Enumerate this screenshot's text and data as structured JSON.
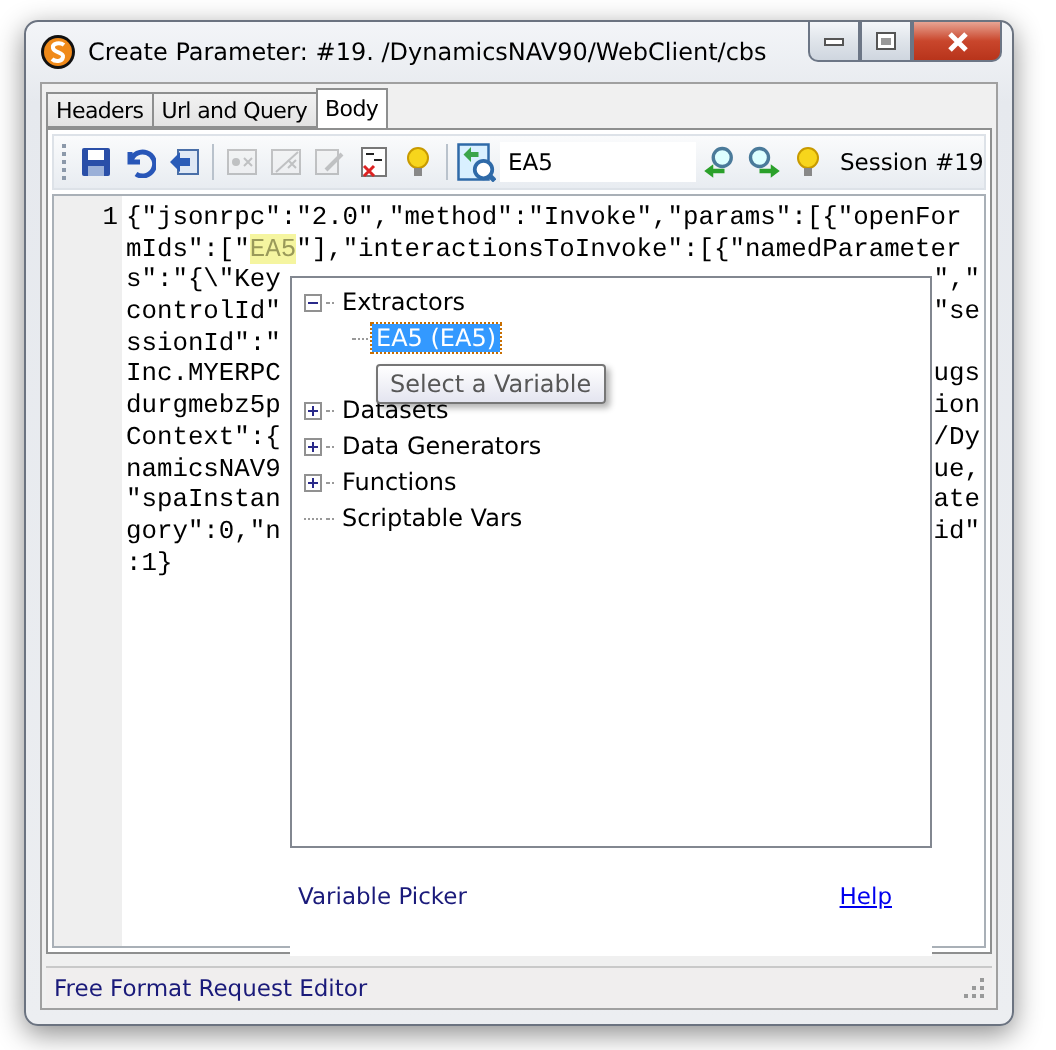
{
  "window": {
    "title": "Create Parameter: #19. /DynamicsNAV90/WebClient/cbs"
  },
  "tabs": [
    {
      "label": "Headers",
      "selected": false
    },
    {
      "label": "Url and Query",
      "selected": false
    },
    {
      "label": "Body",
      "selected": true
    }
  ],
  "toolbar": {
    "buttons": [
      {
        "kind": "save",
        "disabled": false
      },
      {
        "kind": "undo",
        "disabled": false
      },
      {
        "kind": "import",
        "disabled": false
      },
      {
        "kind": "param",
        "disabled": true
      },
      {
        "kind": "param-remove",
        "disabled": true
      },
      {
        "kind": "edit",
        "disabled": true
      },
      {
        "kind": "spellcheck",
        "disabled": false
      },
      {
        "kind": "bulb",
        "disabled": false
      }
    ],
    "search_button": {
      "kind": "find-page"
    },
    "search": {
      "value": "EA5"
    },
    "nav_buttons": [
      {
        "kind": "find-prev"
      },
      {
        "kind": "find-next"
      },
      {
        "kind": "bulb"
      }
    ],
    "session": "Session #19"
  },
  "editor": {
    "lines": [
      {
        "number": "1",
        "segments": [
          {
            "text": "{\"jsonrpc\":\"2.0\",\"method\":\"Invoke\",\"params\":[{\"openFor",
            "highlighted": false
          }
        ]
      },
      {
        "segments": [
          {
            "text": "mIds\":[\"",
            "highlighted": false
          },
          {
            "text": "EA5",
            "highlighted": true
          },
          {
            "text": "\"],\"interactionsToInvoke\":[{\"namedParameter",
            "highlighted": false
          }
        ]
      },
      {
        "segments": [
          {
            "text": "s\":\"{\\\"Key",
            "highlighted": false
          }
        ],
        "right": "\",\""
      },
      {
        "segments": [
          {
            "text": "controlId\"",
            "highlighted": false
          }
        ],
        "right": "\"se"
      },
      {
        "segments": [
          {
            "text": "ssionId\":\"",
            "highlighted": false
          }
        ]
      },
      {
        "segments": [
          {
            "text": "Inc.MYERPC",
            "highlighted": false
          }
        ],
        "right": "ugs"
      },
      {
        "segments": [
          {
            "text": "durgmebz5p",
            "highlighted": false
          }
        ],
        "right": "ion"
      },
      {
        "segments": [
          {
            "text": "Context\":{",
            "highlighted": false
          }
        ],
        "right": "/Dy"
      },
      {
        "segments": [
          {
            "text": "namicsNAV9",
            "highlighted": false
          }
        ],
        "right": "ue,"
      },
      {
        "segments": [
          {
            "text": "\"spaInstan",
            "highlighted": false
          }
        ],
        "right": "ate"
      },
      {
        "segments": [
          {
            "text": "gory\":0,\"n",
            "highlighted": false
          }
        ],
        "right": "id\""
      },
      {
        "segments": [
          {
            "text": ":1}",
            "highlighted": false
          }
        ]
      }
    ]
  },
  "variable_picker": {
    "tree": [
      {
        "label": "Extractors",
        "expanded": true,
        "children": [
          {
            "label": "EA5 (EA5)",
            "selected": true
          }
        ]
      },
      {
        "label": "Datasets",
        "expanded": false
      },
      {
        "label": "Data Generators",
        "expanded": false
      },
      {
        "label": "Functions",
        "expanded": false
      },
      {
        "label": "Scriptable Vars"
      }
    ],
    "tooltip": "Select a Variable",
    "title": "Variable Picker",
    "help_link": "Help"
  },
  "status_bar": "Free Format Request Editor"
}
